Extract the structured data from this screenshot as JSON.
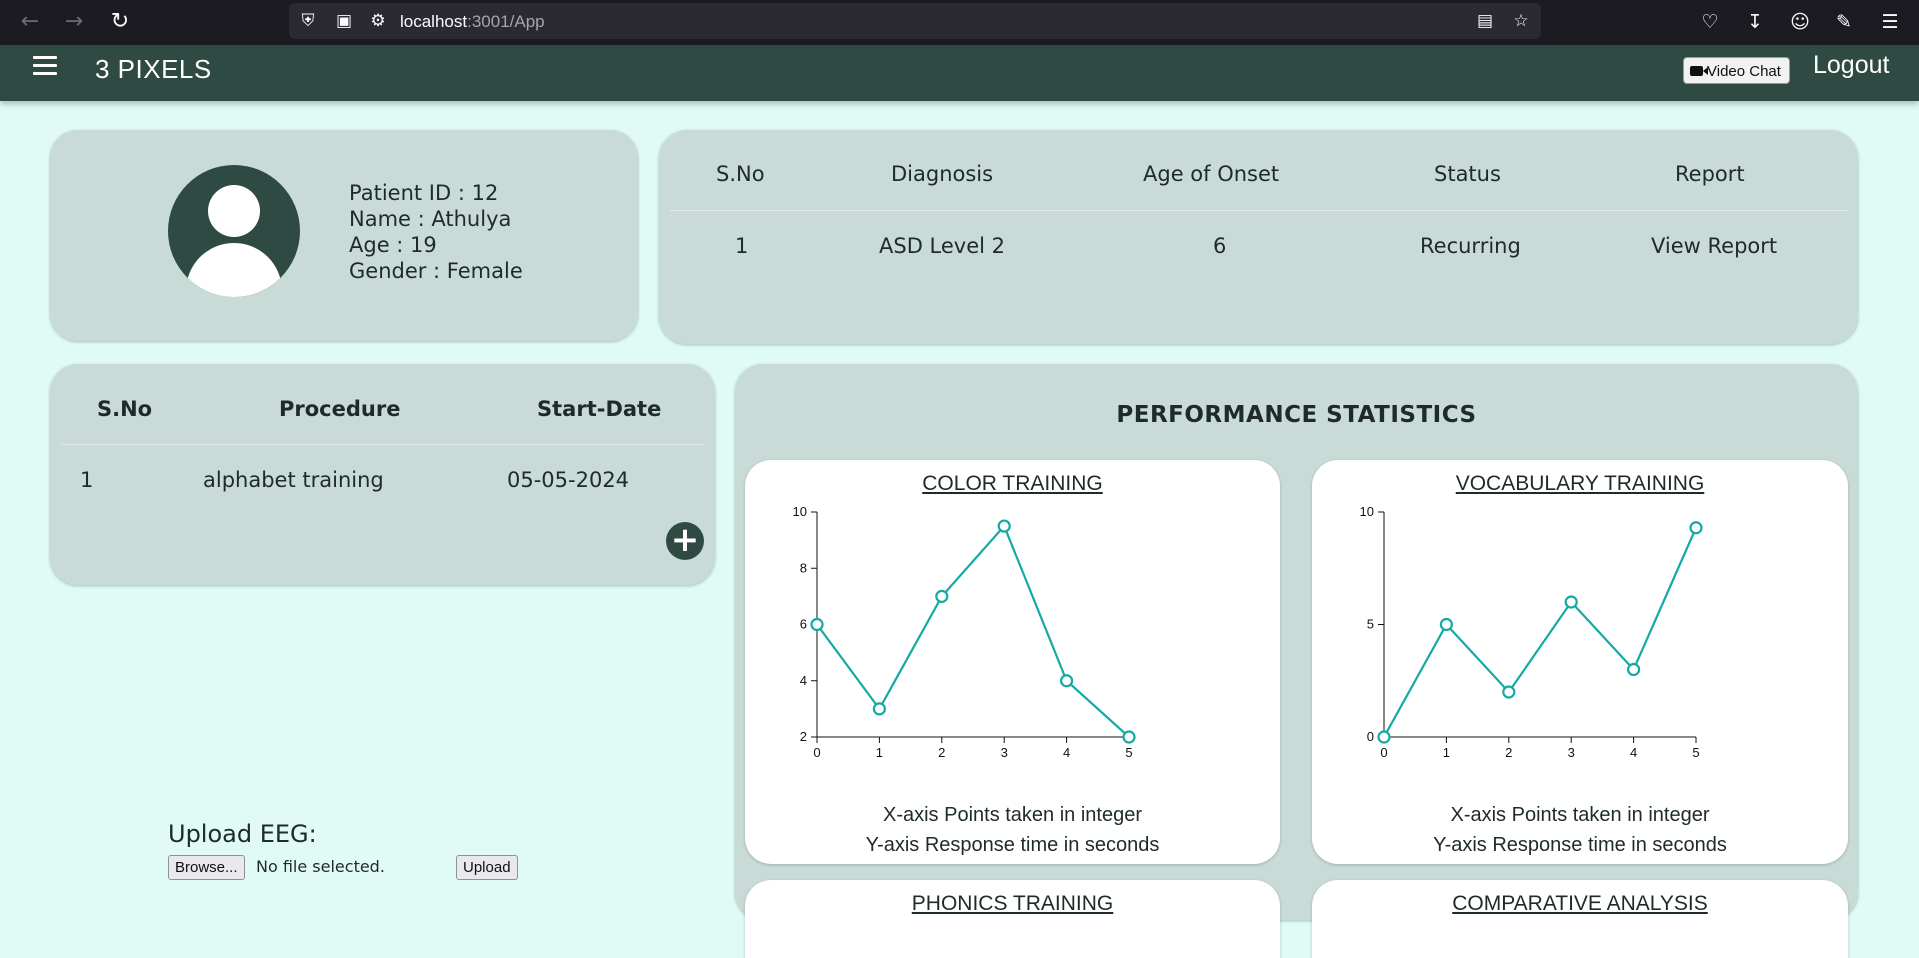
{
  "browser": {
    "url_host": "localhost",
    "url_path": ":3001/App"
  },
  "header": {
    "brand": "3 PIXELS",
    "video_chat_label": "Video Chat",
    "logout_label": "Logout"
  },
  "profile": {
    "patient_id": "Patient ID : 12",
    "name": "Name : Athulya",
    "age": "Age : 19",
    "gender": "Gender : Female"
  },
  "diagnosis_table": {
    "headers": [
      "S.No",
      "Diagnosis",
      "Age of Onset",
      "Status",
      "Report"
    ],
    "rows": [
      [
        "1",
        "ASD Level 2",
        "6",
        "Recurring",
        "View Report"
      ]
    ]
  },
  "procedure_table": {
    "headers": [
      "S.No",
      "Procedure",
      "Start-Date"
    ],
    "rows": [
      [
        "1",
        "alphabet training",
        "05-05-2024"
      ]
    ]
  },
  "upload": {
    "title": "Upload EEG:",
    "browse_label": "Browse...",
    "no_file_text": "No file selected.",
    "upload_label": "Upload"
  },
  "performance": {
    "title": "PERFORMANCE STATISTICS",
    "caption_x": "X-axis Points taken in integer",
    "caption_y": "Y-axis Response time in seconds",
    "line_color": "#14aaa3"
  },
  "chart_data": [
    {
      "type": "line",
      "title": "COLOR TRAINING",
      "x": [
        0,
        1,
        2,
        3,
        4,
        5
      ],
      "values": [
        6,
        3,
        7,
        9.5,
        4,
        2
      ],
      "ylim": [
        2,
        10
      ],
      "yticks": [
        2,
        4,
        6,
        8,
        10
      ],
      "xticks": [
        0,
        1,
        2,
        3,
        4,
        5
      ]
    },
    {
      "type": "line",
      "title": "VOCABULARY TRAINING",
      "x": [
        0,
        1,
        2,
        3,
        4,
        5
      ],
      "values": [
        0,
        5,
        2,
        6,
        3,
        9.3
      ],
      "ylim": [
        0,
        10
      ],
      "yticks": [
        0,
        5,
        10
      ],
      "xticks": [
        0,
        1,
        2,
        3,
        4,
        5
      ]
    },
    {
      "type": "line",
      "title": "PHONICS TRAINING"
    },
    {
      "type": "line",
      "title": "COMPARATIVE ANALYSIS"
    }
  ]
}
